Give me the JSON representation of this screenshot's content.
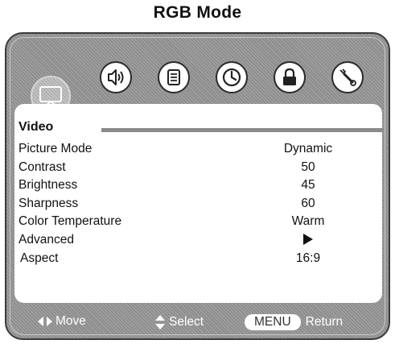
{
  "page": {
    "title": "RGB Mode"
  },
  "tabs": [
    {
      "name": "video",
      "icon": "tv-icon",
      "active": true
    },
    {
      "name": "audio",
      "icon": "speaker-icon",
      "active": false
    },
    {
      "name": "channel",
      "icon": "document-icon",
      "active": false
    },
    {
      "name": "time",
      "icon": "clock-icon",
      "active": false
    },
    {
      "name": "lock",
      "icon": "lock-icon",
      "active": false
    },
    {
      "name": "setup",
      "icon": "wrench-icon",
      "active": false
    }
  ],
  "menu": {
    "section_title": "Video",
    "items": [
      {
        "label": "Picture Mode",
        "value": "Dynamic"
      },
      {
        "label": "Contrast",
        "value": "50"
      },
      {
        "label": "Brightness",
        "value": "45"
      },
      {
        "label": "Sharpness",
        "value": "60"
      },
      {
        "label": "Color Temperature",
        "value": "Warm"
      },
      {
        "label": "Advanced",
        "value": "",
        "value_icon": "play-arrow-icon"
      },
      {
        "label": "Aspect",
        "value": "16:9"
      }
    ]
  },
  "footer": {
    "move_label": "Move",
    "move_icon": "left-right-arrows-icon",
    "select_label": "Select",
    "select_icon": "up-down-arrows-icon",
    "menu_key": "MENU",
    "return_label": "Return"
  },
  "colors": {
    "frame": "#8d8d8d",
    "panel": "#ffffff",
    "footer_text": "#ffffff"
  }
}
